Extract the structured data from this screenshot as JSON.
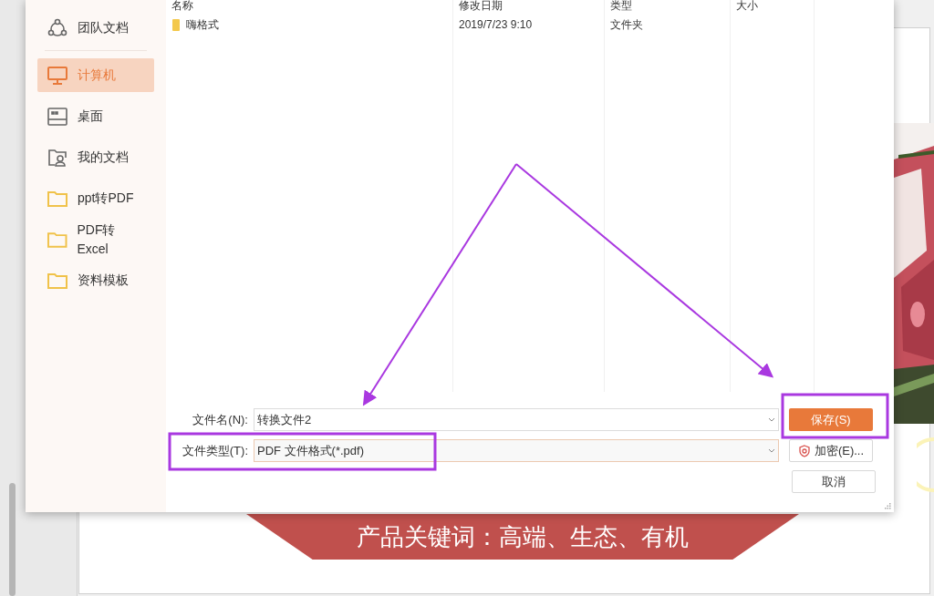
{
  "dialog": {
    "sidebar": {
      "items": [
        {
          "label": "团队文档",
          "kind": "team",
          "selected": false
        },
        {
          "label": "计算机",
          "kind": "computer",
          "selected": true
        },
        {
          "label": "桌面",
          "kind": "desktop",
          "selected": false
        },
        {
          "label": "我的文档",
          "kind": "documents",
          "selected": false
        },
        {
          "label": "ppt转PDF",
          "kind": "folder",
          "selected": false
        },
        {
          "label": "PDF转Excel",
          "kind": "folder",
          "selected": false
        },
        {
          "label": "资料模板",
          "kind": "folder",
          "selected": false
        }
      ]
    },
    "file_list": {
      "columns": [
        "名称",
        "修改日期",
        "类型",
        "大小"
      ],
      "rows": [
        {
          "name": "嗨格式",
          "modified": "2019/7/23 9:10",
          "type": "文件夹"
        }
      ]
    },
    "filename": {
      "label": "文件名(N):",
      "value": "转换文件2"
    },
    "filetype": {
      "label": "文件类型(T):",
      "value": "PDF 文件格式(*.pdf)"
    },
    "buttons": [
      {
        "label": "保存(S)",
        "kind": "primary"
      },
      {
        "label": "加密(E)...",
        "kind": "encrypt"
      },
      {
        "label": "取消",
        "kind": "plain"
      }
    ]
  },
  "slide": {
    "banner_text": "产品关键词：高端、生态、有机"
  }
}
